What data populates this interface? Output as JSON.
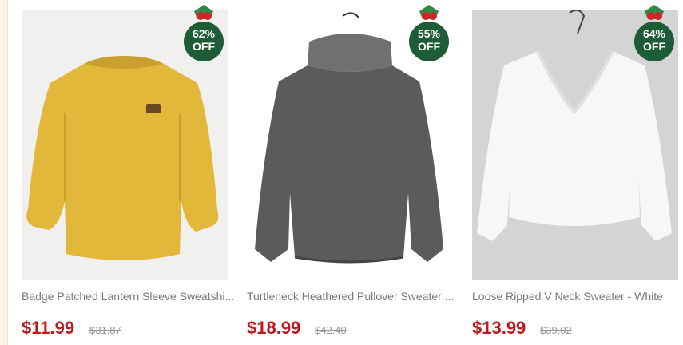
{
  "products": [
    {
      "title": "Badge Patched Lantern Sleeve Sweatshi...",
      "price": "$11.99",
      "old_price": "$31.87",
      "discount": "62%",
      "discount_suffix": "OFF",
      "color": "#e2b83b"
    },
    {
      "title": "Turtleneck Heathered Pullover Sweater ...",
      "price": "$18.99",
      "old_price": "$42.40",
      "discount": "55%",
      "discount_suffix": "OFF",
      "color": "#5b5b5b"
    },
    {
      "title": "Loose Ripped V Neck Sweater - White",
      "price": "$13.99",
      "old_price": "$39.02",
      "discount": "64%",
      "discount_suffix": "OFF",
      "color": "#f7f7f5"
    }
  ],
  "badge": {
    "bg": "#1e5b37",
    "berry": "#d0232a",
    "leaf": "#2f8a46"
  }
}
